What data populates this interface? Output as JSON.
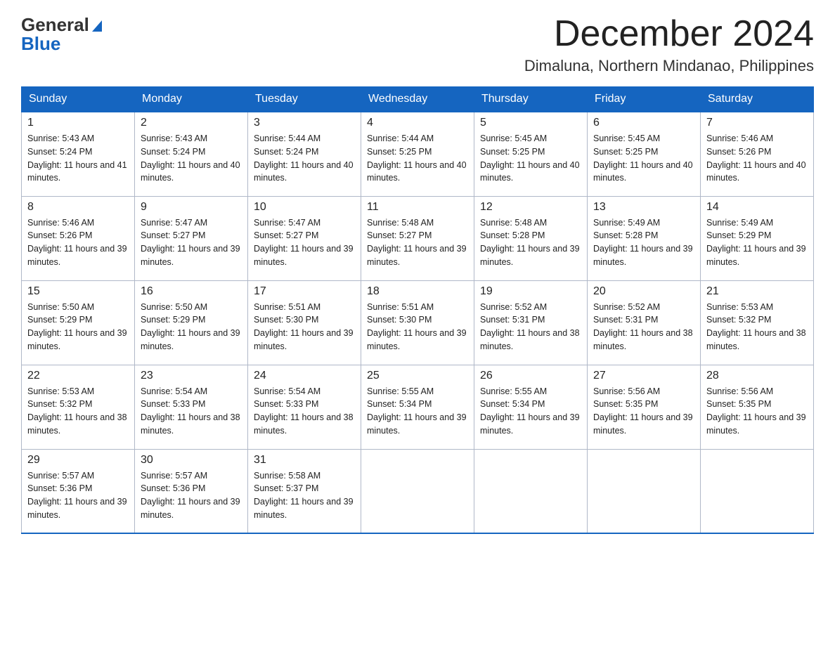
{
  "logo": {
    "general": "General",
    "blue": "Blue",
    "triangle": "▲"
  },
  "title": {
    "month_year": "December 2024",
    "location": "Dimaluna, Northern Mindanao, Philippines"
  },
  "days_of_week": [
    "Sunday",
    "Monday",
    "Tuesday",
    "Wednesday",
    "Thursday",
    "Friday",
    "Saturday"
  ],
  "weeks": [
    [
      {
        "day": "1",
        "sunrise": "5:43 AM",
        "sunset": "5:24 PM",
        "daylight": "11 hours and 41 minutes."
      },
      {
        "day": "2",
        "sunrise": "5:43 AM",
        "sunset": "5:24 PM",
        "daylight": "11 hours and 40 minutes."
      },
      {
        "day": "3",
        "sunrise": "5:44 AM",
        "sunset": "5:24 PM",
        "daylight": "11 hours and 40 minutes."
      },
      {
        "day": "4",
        "sunrise": "5:44 AM",
        "sunset": "5:25 PM",
        "daylight": "11 hours and 40 minutes."
      },
      {
        "day": "5",
        "sunrise": "5:45 AM",
        "sunset": "5:25 PM",
        "daylight": "11 hours and 40 minutes."
      },
      {
        "day": "6",
        "sunrise": "5:45 AM",
        "sunset": "5:25 PM",
        "daylight": "11 hours and 40 minutes."
      },
      {
        "day": "7",
        "sunrise": "5:46 AM",
        "sunset": "5:26 PM",
        "daylight": "11 hours and 40 minutes."
      }
    ],
    [
      {
        "day": "8",
        "sunrise": "5:46 AM",
        "sunset": "5:26 PM",
        "daylight": "11 hours and 39 minutes."
      },
      {
        "day": "9",
        "sunrise": "5:47 AM",
        "sunset": "5:27 PM",
        "daylight": "11 hours and 39 minutes."
      },
      {
        "day": "10",
        "sunrise": "5:47 AM",
        "sunset": "5:27 PM",
        "daylight": "11 hours and 39 minutes."
      },
      {
        "day": "11",
        "sunrise": "5:48 AM",
        "sunset": "5:27 PM",
        "daylight": "11 hours and 39 minutes."
      },
      {
        "day": "12",
        "sunrise": "5:48 AM",
        "sunset": "5:28 PM",
        "daylight": "11 hours and 39 minutes."
      },
      {
        "day": "13",
        "sunrise": "5:49 AM",
        "sunset": "5:28 PM",
        "daylight": "11 hours and 39 minutes."
      },
      {
        "day": "14",
        "sunrise": "5:49 AM",
        "sunset": "5:29 PM",
        "daylight": "11 hours and 39 minutes."
      }
    ],
    [
      {
        "day": "15",
        "sunrise": "5:50 AM",
        "sunset": "5:29 PM",
        "daylight": "11 hours and 39 minutes."
      },
      {
        "day": "16",
        "sunrise": "5:50 AM",
        "sunset": "5:29 PM",
        "daylight": "11 hours and 39 minutes."
      },
      {
        "day": "17",
        "sunrise": "5:51 AM",
        "sunset": "5:30 PM",
        "daylight": "11 hours and 39 minutes."
      },
      {
        "day": "18",
        "sunrise": "5:51 AM",
        "sunset": "5:30 PM",
        "daylight": "11 hours and 39 minutes."
      },
      {
        "day": "19",
        "sunrise": "5:52 AM",
        "sunset": "5:31 PM",
        "daylight": "11 hours and 38 minutes."
      },
      {
        "day": "20",
        "sunrise": "5:52 AM",
        "sunset": "5:31 PM",
        "daylight": "11 hours and 38 minutes."
      },
      {
        "day": "21",
        "sunrise": "5:53 AM",
        "sunset": "5:32 PM",
        "daylight": "11 hours and 38 minutes."
      }
    ],
    [
      {
        "day": "22",
        "sunrise": "5:53 AM",
        "sunset": "5:32 PM",
        "daylight": "11 hours and 38 minutes."
      },
      {
        "day": "23",
        "sunrise": "5:54 AM",
        "sunset": "5:33 PM",
        "daylight": "11 hours and 38 minutes."
      },
      {
        "day": "24",
        "sunrise": "5:54 AM",
        "sunset": "5:33 PM",
        "daylight": "11 hours and 38 minutes."
      },
      {
        "day": "25",
        "sunrise": "5:55 AM",
        "sunset": "5:34 PM",
        "daylight": "11 hours and 39 minutes."
      },
      {
        "day": "26",
        "sunrise": "5:55 AM",
        "sunset": "5:34 PM",
        "daylight": "11 hours and 39 minutes."
      },
      {
        "day": "27",
        "sunrise": "5:56 AM",
        "sunset": "5:35 PM",
        "daylight": "11 hours and 39 minutes."
      },
      {
        "day": "28",
        "sunrise": "5:56 AM",
        "sunset": "5:35 PM",
        "daylight": "11 hours and 39 minutes."
      }
    ],
    [
      {
        "day": "29",
        "sunrise": "5:57 AM",
        "sunset": "5:36 PM",
        "daylight": "11 hours and 39 minutes."
      },
      {
        "day": "30",
        "sunrise": "5:57 AM",
        "sunset": "5:36 PM",
        "daylight": "11 hours and 39 minutes."
      },
      {
        "day": "31",
        "sunrise": "5:58 AM",
        "sunset": "5:37 PM",
        "daylight": "11 hours and 39 minutes."
      },
      null,
      null,
      null,
      null
    ]
  ]
}
